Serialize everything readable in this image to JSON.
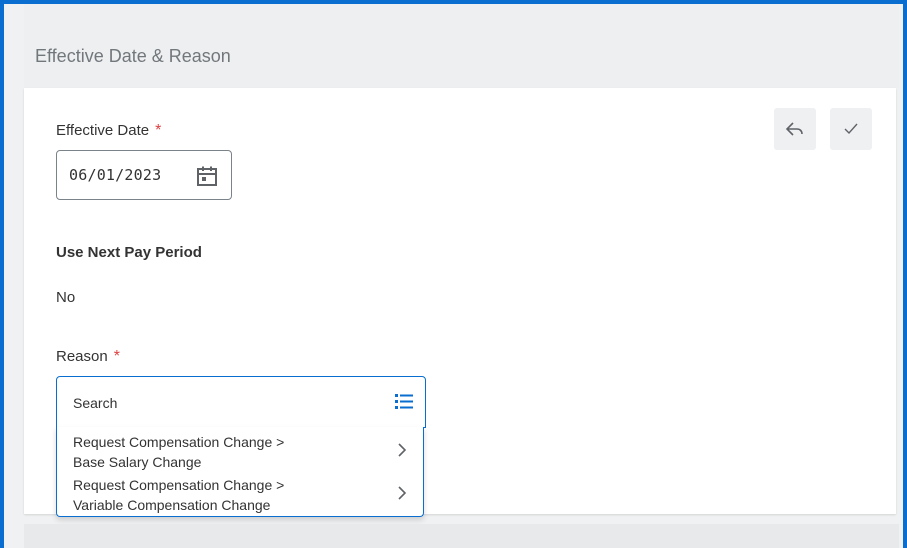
{
  "section": {
    "title": "Effective Date & Reason"
  },
  "effective_date": {
    "label": "Effective Date",
    "required_mark": "*",
    "value": "06/01/2023",
    "icon": "calendar-icon"
  },
  "next_pay_period": {
    "label": "Use Next Pay Period",
    "value": "No"
  },
  "reason": {
    "label": "Reason",
    "required_mark": "*",
    "placeholder": "Search",
    "list_icon": "list-icon",
    "options": [
      {
        "line1": "Request Compensation Change >",
        "line2": "Base Salary Change"
      },
      {
        "line1": "Request Compensation Change >",
        "line2": "Variable Compensation Change"
      }
    ]
  },
  "actions": {
    "cancel_icon": "undo-icon",
    "confirm_icon": "check-icon"
  },
  "colors": {
    "accent": "#0a6ed1",
    "required": "#de4040"
  }
}
